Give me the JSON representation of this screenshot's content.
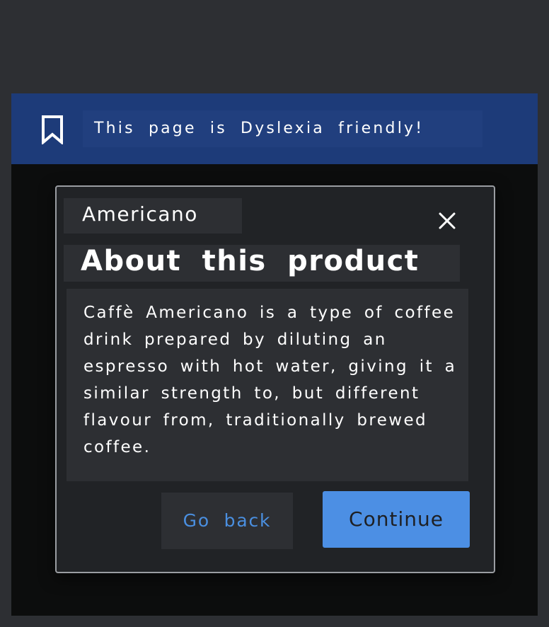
{
  "banner": {
    "icon": "bookmark-icon",
    "text": "This page is Dyslexia friendly!",
    "color": "#1d3b79"
  },
  "dialog": {
    "subtitle": "Americano",
    "close_icon": "close-icon",
    "title": "About this product",
    "description": "Caffè Americano is a type of coffee drink prepared by diluting an espresso with hot water, giving it a similar strength to, but different flavour from, traditionally brewed coffee.",
    "buttons": {
      "back_label": "Go back",
      "continue_label": "Continue"
    },
    "accent_color": "#4c8fe4"
  }
}
